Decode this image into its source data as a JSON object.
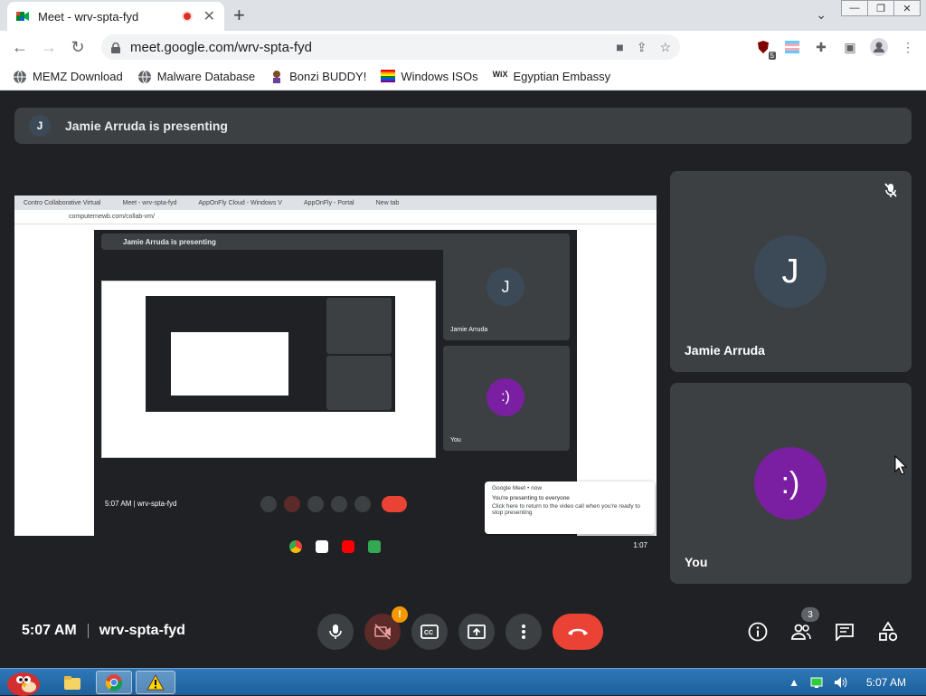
{
  "browser": {
    "tab_title": "Meet - wrv-spta-fyd",
    "url": "meet.google.com/wrv-spta-fyd",
    "extension_badge": "5"
  },
  "bookmarks": [
    {
      "label": "MEMZ Download"
    },
    {
      "label": "Malware Database"
    },
    {
      "label": "Bonzi BUDDY!"
    },
    {
      "label": "Windows ISOs"
    },
    {
      "label": "Egyptian Embassy"
    }
  ],
  "meet": {
    "presenting_text": "Jamie Arruda is presenting",
    "presenter_initial": "J",
    "participants": [
      {
        "name": "Jamie Arruda",
        "initial": "J",
        "avatar_color": "#3c4a57"
      },
      {
        "name": "You",
        "initial": ":)",
        "avatar_color": "#7b1fa2"
      }
    ],
    "time": "5:07 AM",
    "meeting_code": "wrv-spta-fyd",
    "camera_alert_badge": "!",
    "people_count": "3"
  },
  "shared_screen": {
    "tabs": [
      "Contro Collaborative Virtual",
      "Meet - wrv-spta-fyd",
      "AppOnFly Cloud - Windows V",
      "AppOnFly - Portal",
      "New tab"
    ],
    "url": "computernewb.com/collab-vm/",
    "presenting_text": "Jamie Arruda is presenting",
    "participant1": "Jamie Arruda",
    "participant2": "You",
    "bottom_time": "5:07 AM",
    "bottom_code": "wrv-spta-fyd",
    "notif_source": "Google Meet • now",
    "notif_title": "You're presenting to everyone",
    "notif_body": "Click here to return to the video call when you're ready to stop presenting",
    "shelf_time": "1:07"
  },
  "taskbar": {
    "time": "5:07 AM"
  }
}
